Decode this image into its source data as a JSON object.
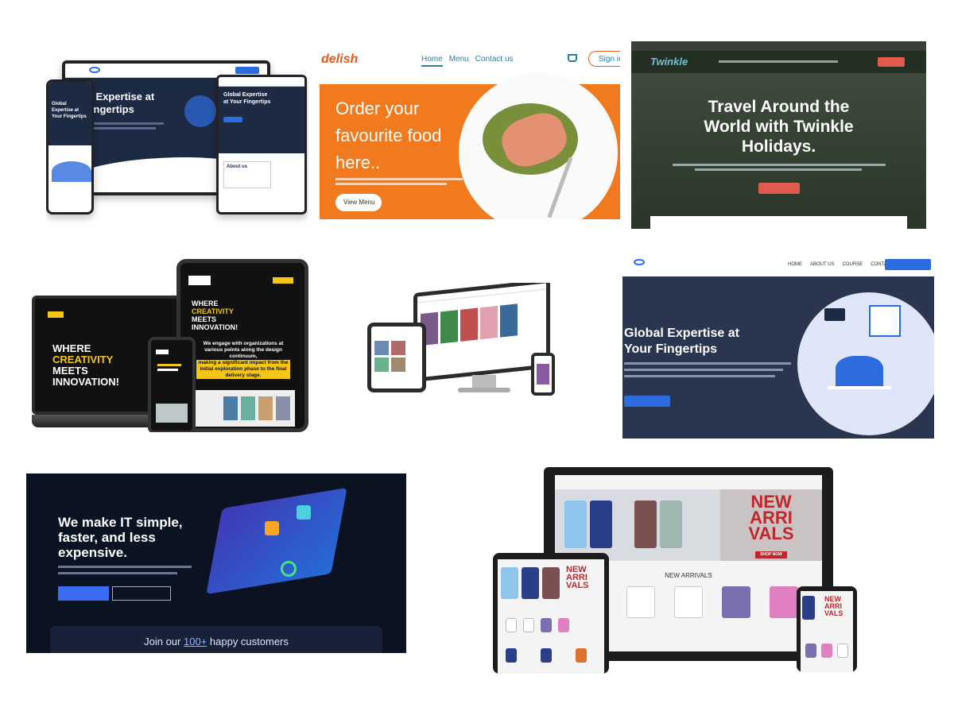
{
  "tile1": {
    "heading_a": "al Expertise at",
    "heading_b": "Fingertips",
    "tablet_heading": "Global Expertise at Your Fingertips",
    "about_label": "About us",
    "phone_heading": "Global Expertise at Your Fingertips",
    "colors": {
      "navy": "#1d2a44",
      "blue": "#2d6cdf"
    }
  },
  "tile2": {
    "logo": "delish",
    "nav": [
      "Home",
      "Menu",
      "Contact us"
    ],
    "signin": "Sign in",
    "hero_line1": "Order your",
    "hero_line2": "favourite food",
    "hero_line3": "here..",
    "cta": "View Menu",
    "colors": {
      "orange": "#f07a1d",
      "brand": "#e65a1f"
    }
  },
  "tile3": {
    "logo": "Twinkle",
    "heading_line1": "Travel Around the",
    "heading_line2": "World with Twinkle",
    "heading_line3": "Holidays.",
    "colors": {
      "cta": "#e05a4e"
    }
  },
  "tile4": {
    "laptop_line1": "WHERE",
    "laptop_line2": "CREATIVITY",
    "laptop_line3": "MEETS",
    "laptop_line4": "INNOVATION!",
    "tablet_line1": "WHERE",
    "tablet_line2": "CREATIVITY",
    "tablet_line3": "MEETS",
    "tablet_line4": "INNOVATION!",
    "tablet_body_1": "We engage with organizations at various points along the design continuum,",
    "tablet_body_2": "making a significant impact from the initial exploration phase to the final delivery stage.",
    "colors": {
      "yellow": "#f5c518"
    }
  },
  "tile6": {
    "nav": [
      "HOME",
      "ABOUT US",
      "COURSE",
      "CONTACT"
    ],
    "heading_line1": "Global Expertise at",
    "heading_line2": "Your Fingertips",
    "colors": {
      "blue": "#2d6cdf"
    }
  },
  "tile7": {
    "heading_line1": "We make IT simple,",
    "heading_line2": "faster, and less",
    "heading_line3": "expensive.",
    "join_prefix": "Join our ",
    "join_highlight": "100+",
    "join_suffix": " happy customers",
    "colors": {
      "bg": "#0b1221",
      "accent": "#3b6cf5"
    }
  },
  "tile8": {
    "banner_line1": "NEW",
    "banner_line2": "ARRI",
    "banner_line3": "VALS",
    "shop_now": "SHOP NOW",
    "section_title": "NEW ARRIVALS",
    "tablet_banner_1": "NEW",
    "tablet_banner_2": "ARRI",
    "tablet_banner_3": "VALS",
    "phone_banner_1": "NEW",
    "phone_banner_2": "ARRI",
    "phone_banner_3": "VALS",
    "colors": {
      "red": "#c0272d"
    }
  }
}
